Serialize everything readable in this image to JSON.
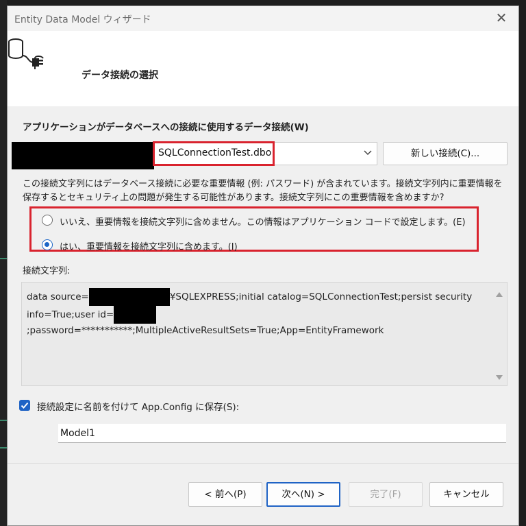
{
  "window": {
    "title": "Entity Data Model ウィザード",
    "close_glyph": "✕"
  },
  "header": {
    "title": "データ接続の選択",
    "icon": "database-connection-icon"
  },
  "connection": {
    "label": "アプリケーションがデータベースへの接続に使用するデータ接続(W)",
    "selected_value": "SQLConnectionTest.dbo",
    "new_connection_button": "新しい接続(C)..."
  },
  "warning_text": "この接続文字列にはデータベース接続に必要な重要情報 (例: パスワード) が含まれています。接続文字列内に重要情報を保存するとセキュリティ上の問題が発生する可能性があります。接続文字列にこの重要情報を含めますか?",
  "sensitive_options": [
    {
      "label": "いいえ、重要情報を接続文字列に含めません。この情報はアプリケーション コードで設定します。(E)",
      "checked": false
    },
    {
      "label": "はい、重要情報を接続文字列に含めます。(I)",
      "checked": true
    }
  ],
  "connection_string": {
    "label": "接続文字列:",
    "part1": "data source=",
    "part2": "¥SQLEXPRESS;initial catalog=SQLConnectionTest;persist security info=True;user id=",
    "part3": ";password=***********;MultipleActiveResultSets=True;App=EntityFramework"
  },
  "save_setting": {
    "label": "接続設定に名前を付けて App.Config に保存(S):",
    "checked": true,
    "value": "Model1"
  },
  "buttons": {
    "back": "< 前へ(P)",
    "next": "次へ(N) >",
    "finish": "完了(F)",
    "cancel": "キャンセル"
  },
  "colors": {
    "highlight": "#d9232e",
    "accent": "#1f63c5"
  }
}
